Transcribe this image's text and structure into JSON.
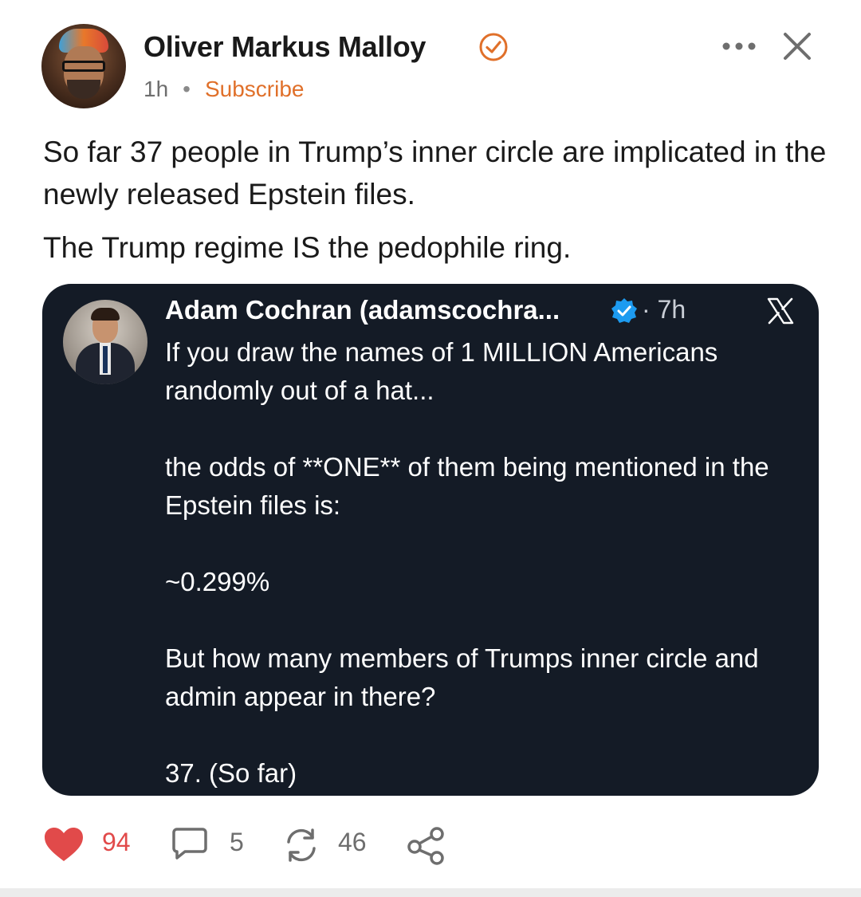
{
  "post": {
    "author": "Oliver Markus Malloy",
    "time": "1h",
    "separator": "•",
    "subscribe_label": "Subscribe",
    "paragraphs": [
      "So far 37 people in Trump’s inner circle are implicated in the newly released Epstein files.",
      "The Trump regime IS the pedophile ring."
    ],
    "icons": {
      "verified": "verified-check-icon",
      "more": "more-horizontal-icon",
      "close": "close-icon"
    },
    "accent_color": "#e0702a"
  },
  "embedded_post": {
    "author": "Adam Cochran (adamscochra...",
    "time": "· 7h",
    "platform_icon": "x-logo-icon",
    "paragraphs": [
      "If you draw the names of 1 MILLION Americans randomly out of a hat...",
      "the odds of **ONE** of them being mentioned in the Epstein files is:",
      "~0.299%",
      "But how many members of Trumps inner circle and admin appear in there?",
      "37. (So far)"
    ],
    "background_color": "#141b26",
    "verified_color": "#1d9bf0"
  },
  "actions": {
    "likes": "94",
    "comments": "5",
    "restacks": "46",
    "like_color": "#e14a4a"
  }
}
